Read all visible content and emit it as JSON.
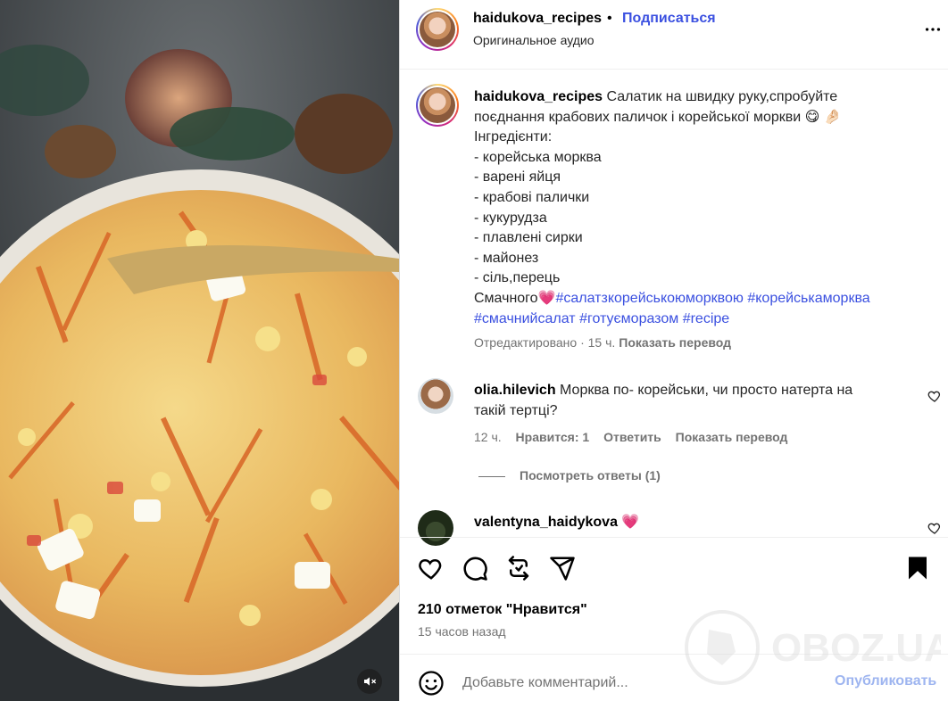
{
  "post": {
    "username": "haidukova_recipes",
    "separator": "•",
    "follow_label": "Подписаться",
    "audio": "Оригинальное аудио",
    "more_icon": "more-horizontal-icon"
  },
  "caption": {
    "username": "haidukova_recipes",
    "line1": "Салатик на швидку руку,спробуйте",
    "line2": "поєднання крабових паличок і корейської моркви 😋 🤌🏻",
    "line3": "Інгредієнти:",
    "items": [
      "- корейська морква",
      "- варені яйця",
      "- крабові палички",
      "- кукурудза",
      "- плавлені сирки",
      "- майонез",
      "- сіль,перець"
    ],
    "closing": "Смачного💗",
    "tag1": "#салатзкорейськоюморквою",
    "tag2": "#корейськаморква",
    "tag3": "#смачнийсалат",
    "tag4": "#готуєморазом",
    "tag5": "#recipe",
    "edited": "Отредактировано · 15 ч.",
    "translate": "Показать перевод"
  },
  "comments": [
    {
      "username": "olia.hilevich",
      "text_line1": "Морква по- корейськи, чи просто натерта на",
      "text_line2": "такій тертці?",
      "time": "12 ч.",
      "likes": "Нравится: 1",
      "reply": "Ответить",
      "translate": "Показать перевод",
      "view_replies": "Посмотреть ответы (1)"
    },
    {
      "username": "valentyna_haidykova",
      "text": "💗"
    }
  ],
  "actions": {
    "like_icon": "heart-icon",
    "comment_icon": "comment-icon",
    "repost_icon": "repost-icon",
    "share_icon": "send-icon",
    "save_icon": "bookmark-icon",
    "likes_text": "210 отметок \"Нравится\"",
    "time_ago": "15 часов назад"
  },
  "comment_bar": {
    "emoji_icon": "emoji-icon",
    "placeholder": "Добавьте комментарий...",
    "publish_label": "Опубликовать"
  },
  "watermark": "OBOZ.UA",
  "colors": {
    "link": "#3b50e0",
    "publish_disabled": "#9eb5f0",
    "muted": "#737373"
  }
}
